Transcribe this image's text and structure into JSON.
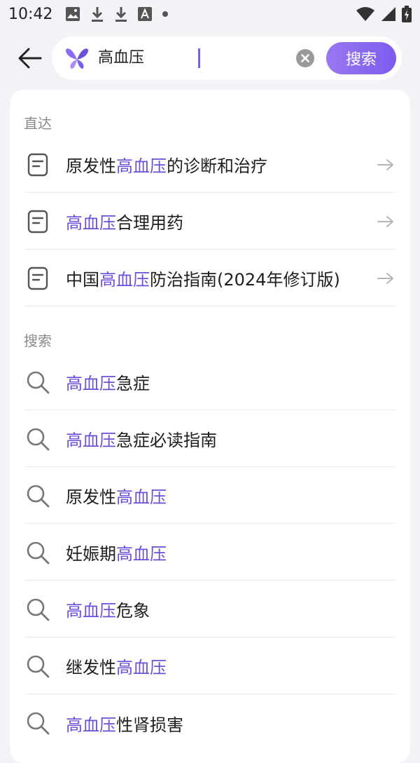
{
  "status_bar": {
    "time": "10:42",
    "left_icons": [
      "image-icon",
      "download-icon",
      "download-icon",
      "font-icon",
      "dot-icon"
    ],
    "right_icons": [
      "wifi-icon",
      "signal-icon",
      "battery-icon"
    ]
  },
  "search": {
    "query": "高血压",
    "button_label": "搜索",
    "accent_color": "#7b5cf0"
  },
  "direct_section": {
    "header": "直达",
    "items": [
      {
        "pre": "原发性",
        "hl": "高血压",
        "post": "的诊断和治疗"
      },
      {
        "pre": "",
        "hl": "高血压",
        "post": "合理用药"
      },
      {
        "pre": "中国",
        "hl": "高血压",
        "post": "防治指南(2024年修订版)"
      }
    ]
  },
  "search_section": {
    "header": "搜索",
    "items": [
      {
        "pre": "",
        "hl": "高血压",
        "post": "急症"
      },
      {
        "pre": "",
        "hl": "高血压",
        "post": "急症必读指南"
      },
      {
        "pre": "原发性",
        "hl": "高血压",
        "post": ""
      },
      {
        "pre": "妊娠期",
        "hl": "高血压",
        "post": ""
      },
      {
        "pre": "",
        "hl": "高血压",
        "post": "危象"
      },
      {
        "pre": "继发性",
        "hl": "高血压",
        "post": ""
      },
      {
        "pre": "",
        "hl": "高血压",
        "post": "性肾损害"
      }
    ]
  }
}
